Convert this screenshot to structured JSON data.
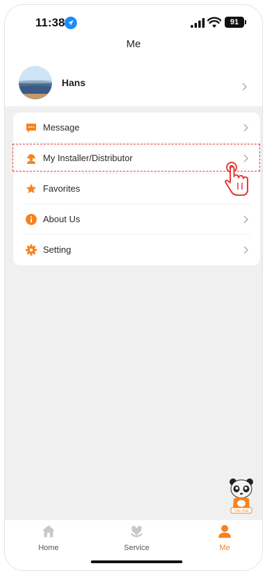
{
  "status_bar": {
    "time": "11:38",
    "battery": "91"
  },
  "header": {
    "title": "Me"
  },
  "profile": {
    "name": "Hans"
  },
  "menu": {
    "items": [
      {
        "label": "Message",
        "icon": "message-icon"
      },
      {
        "label": "My Installer/Distributor",
        "icon": "installer-icon"
      },
      {
        "label": "Favorites",
        "icon": "star-icon"
      },
      {
        "label": "About Us",
        "icon": "info-icon"
      },
      {
        "label": "Setting",
        "icon": "gear-icon"
      }
    ]
  },
  "mascot": {
    "badge": "Live chat"
  },
  "bottom_nav": {
    "items": [
      {
        "label": "Home",
        "icon": "home-icon"
      },
      {
        "label": "Service",
        "icon": "service-icon"
      },
      {
        "label": "Me",
        "icon": "person-icon",
        "active": true
      }
    ]
  },
  "colors": {
    "accent": "#f5831f",
    "highlight": "#e53935",
    "background": "#f0f0f0"
  }
}
